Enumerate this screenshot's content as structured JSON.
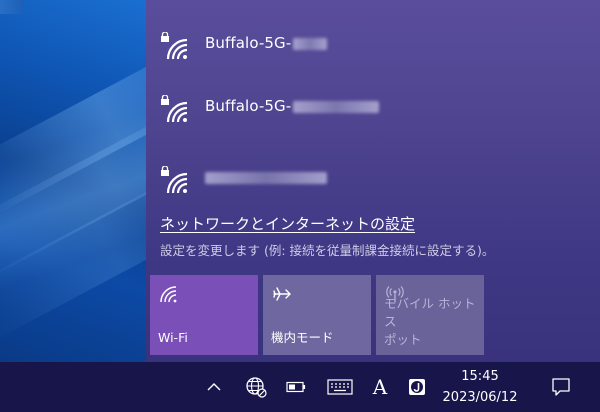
{
  "networks": [
    {
      "ssid_visible": "Buffalo-5G-",
      "secured": true,
      "redacted_width": 34
    },
    {
      "ssid_visible": "Buffalo-5G-",
      "secured": true,
      "redacted_width": 86
    },
    {
      "ssid_visible": "",
      "secured": true,
      "redacted_width": 122
    }
  ],
  "settings": {
    "link": "ネットワークとインターネットの設定",
    "description": "設定を変更します (例: 接続を従量制課金接続に設定する)。"
  },
  "tiles": [
    {
      "label": "Wi-Fi",
      "icon": "wifi-icon",
      "state": "on"
    },
    {
      "label": "機内モード",
      "icon": "airplane-icon",
      "state": "off"
    },
    {
      "label": "モバイル ホットス\nポット",
      "icon": "hotspot-icon",
      "state": "disabled"
    }
  ],
  "taskbar": {
    "ime_mode": "A",
    "time": "15:45",
    "date": "2023/06/12",
    "icons": [
      "chevron-up-icon",
      "globe-network-icon",
      "battery-icon",
      "keyboard-icon",
      "ime-a-icon",
      "app-j-icon",
      "notification-icon"
    ]
  },
  "colors": {
    "flyout": "#4e448f",
    "wifi_tile_active": "#7a4fb8",
    "tile_inactive": "#6f679f",
    "taskbar": "#17154a"
  }
}
